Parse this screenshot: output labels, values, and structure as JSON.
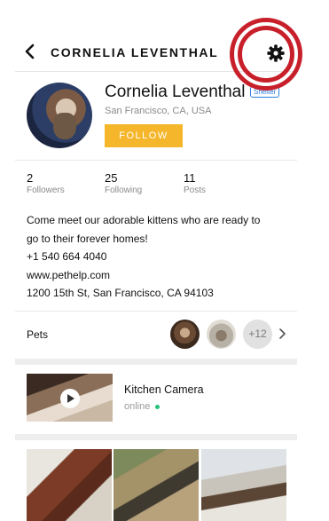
{
  "header": {
    "title": "CORNELIA LEVENTHAL"
  },
  "profile": {
    "name": "Cornelia Leventhal",
    "badge": "Shelter",
    "location": "San Francisco, CA, USA",
    "follow_label": "FOLLOW"
  },
  "stats": [
    {
      "value": "2",
      "label": "Followers"
    },
    {
      "value": "25",
      "label": "Following"
    },
    {
      "value": "11",
      "label": "Posts"
    }
  ],
  "bio": {
    "line1": "Come meet our adorable kittens who are ready to",
    "line2": "go to their forever homes!",
    "phone": "+1 540 664 4040",
    "website": "www.pethelp.com",
    "address": "1200 15th St, San Francisco, CA 94103"
  },
  "pets": {
    "label": "Pets",
    "more_count": "+12"
  },
  "camera": {
    "name": "Kitchen Camera",
    "status": "online"
  },
  "colors": {
    "follow": "#f5b62b",
    "badge": "#2d7fe0",
    "online": "#27c27a",
    "annotation": "#c8202a"
  },
  "icons": {
    "back": "chevron-left-icon",
    "settings": "gear-icon",
    "pets_more": "chevron-right-icon",
    "play": "play-icon"
  }
}
